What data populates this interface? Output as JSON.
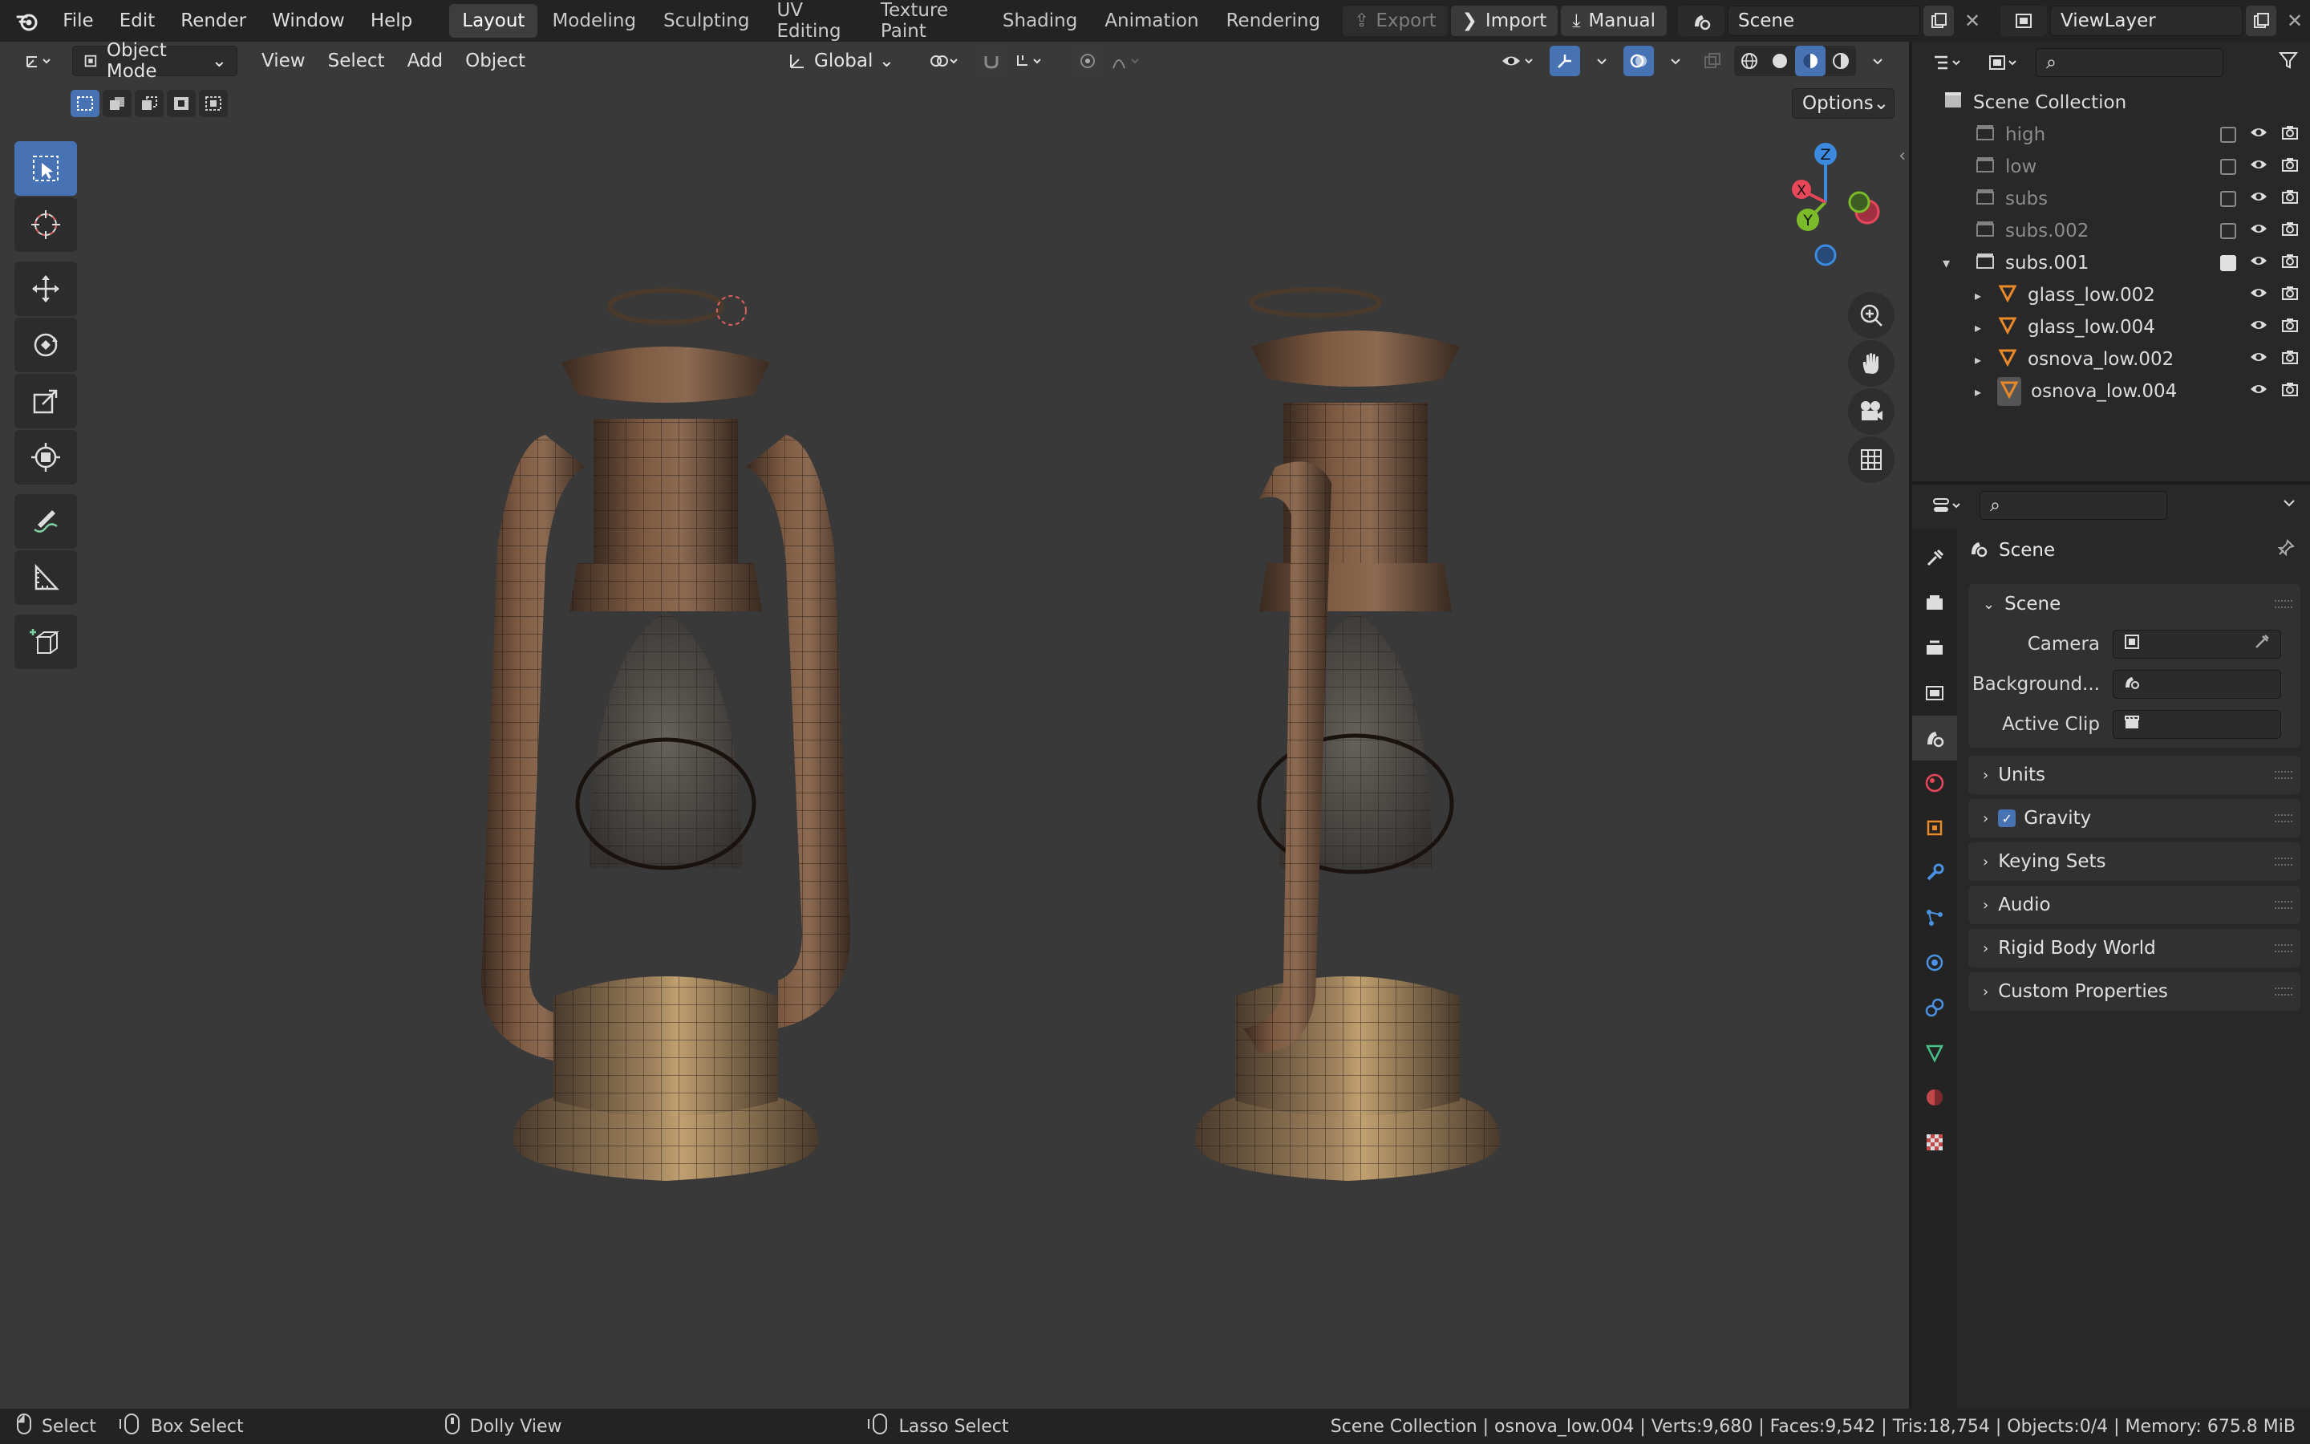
{
  "topbar": {
    "menus": [
      "File",
      "Edit",
      "Render",
      "Window",
      "Help"
    ],
    "workspaces": [
      "Layout",
      "Modeling",
      "Sculpting",
      "UV Editing",
      "Texture Paint",
      "Shading",
      "Animation",
      "Rendering"
    ],
    "active_workspace": "Layout",
    "export_label": "Export",
    "import_label": "Import",
    "manual_label": "Manual",
    "scene_name": "Scene",
    "view_layer": "ViewLayer"
  },
  "viewport": {
    "mode": "Object Mode",
    "menus": [
      "View",
      "Select",
      "Add",
      "Object"
    ],
    "orientation": "Global",
    "options_label": "Options",
    "gizmo": {
      "z": "Z",
      "y": "Y",
      "x": "X"
    }
  },
  "outliner": {
    "root": "Scene Collection",
    "items": [
      {
        "name": "high",
        "dim": true,
        "checked": false
      },
      {
        "name": "low",
        "dim": true,
        "checked": false
      },
      {
        "name": "subs",
        "dim": true,
        "checked": false
      },
      {
        "name": "subs.002",
        "dim": true,
        "checked": false
      },
      {
        "name": "subs.001",
        "dim": false,
        "checked": true
      }
    ],
    "children": [
      "glass_low.002",
      "glass_low.004",
      "osnova_low.002",
      "osnova_low.004"
    ]
  },
  "properties": {
    "context_title": "Scene",
    "scene_panel": {
      "title": "Scene",
      "camera_label": "Camera",
      "background_label": "Background...",
      "active_clip_label": "Active Clip"
    },
    "panels": [
      "Units",
      "Gravity",
      "Keying Sets",
      "Audio",
      "Rigid Body World",
      "Custom Properties"
    ],
    "gravity_checked": true
  },
  "statusbar": {
    "select": "Select",
    "box_select": "Box Select",
    "dolly_view": "Dolly View",
    "lasso_select": "Lasso Select",
    "stats": "Scene Collection | osnova_low.004 | Verts:9,680 | Faces:9,542 | Tris:18,754 | Objects:0/4 | Memory: 675.8 MiB"
  },
  "colors": {
    "accent": "#4772b3",
    "viewport_bg": "#393939",
    "axis_x": "#e8475a",
    "axis_y": "#7bbb2a",
    "axis_z": "#3c8ae0",
    "rust": "#6b4a33"
  }
}
